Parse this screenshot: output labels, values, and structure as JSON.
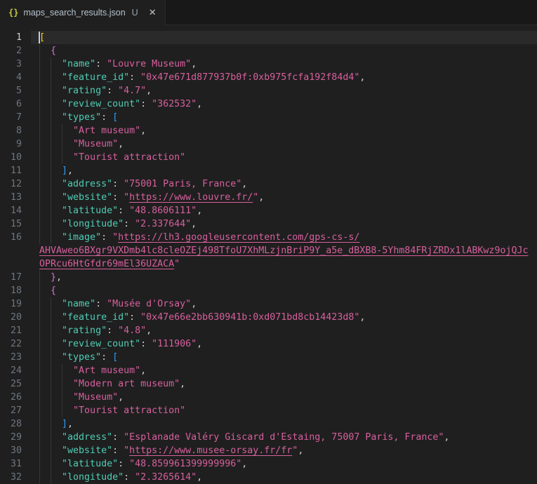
{
  "colors": {
    "editor_bg": "#1f1f1f",
    "tabbar_bg": "#181818",
    "tab_active_bg": "#1f1f1f",
    "tab_border": "#2b2b2b",
    "line_highlight": "#2a2a2a",
    "line_number": "#6e7681",
    "line_number_active": "#cccccc",
    "indent_guide": "#363636",
    "cursor": "#c3ccd5",
    "p": "#cccccc",
    "k": "#4fcdb5",
    "s": "#d7609e",
    "u": "#d7609e",
    "b1": "#ffd602",
    "b2": "#d670d6",
    "b3": "#2f9cf5",
    "tab_label": "#b4c2ce",
    "tab_badge": "#9aa7b0",
    "json_icon": "#cbcb41",
    "close_icon": "#c5c5c5"
  },
  "tab": {
    "icon": "{}",
    "label": "maps_search_results.json",
    "modified_badge": "U",
    "close": "✕"
  },
  "editor": {
    "active_line": 1,
    "lines": [
      {
        "num": "1",
        "ind": 0,
        "seg": [
          [
            "[",
            "b1"
          ]
        ]
      },
      {
        "num": "2",
        "ind": 2,
        "seg": [
          [
            "  ",
            "p"
          ],
          [
            "{",
            "b2"
          ]
        ]
      },
      {
        "num": "3",
        "ind": 4,
        "seg": [
          [
            "    ",
            "p"
          ],
          [
            "\"name\"",
            "k"
          ],
          [
            ": ",
            "p"
          ],
          [
            "\"Louvre Museum\"",
            "s"
          ],
          [
            ",",
            "p"
          ]
        ]
      },
      {
        "num": "4",
        "ind": 4,
        "seg": [
          [
            "    ",
            "p"
          ],
          [
            "\"feature_id\"",
            "k"
          ],
          [
            ": ",
            "p"
          ],
          [
            "\"0x47e671d877937b0f:0xb975fcfa192f84d4\"",
            "s"
          ],
          [
            ",",
            "p"
          ]
        ]
      },
      {
        "num": "5",
        "ind": 4,
        "seg": [
          [
            "    ",
            "p"
          ],
          [
            "\"rating\"",
            "k"
          ],
          [
            ": ",
            "p"
          ],
          [
            "\"4.7\"",
            "s"
          ],
          [
            ",",
            "p"
          ]
        ]
      },
      {
        "num": "6",
        "ind": 4,
        "seg": [
          [
            "    ",
            "p"
          ],
          [
            "\"review_count\"",
            "k"
          ],
          [
            ": ",
            "p"
          ],
          [
            "\"362532\"",
            "s"
          ],
          [
            ",",
            "p"
          ]
        ]
      },
      {
        "num": "7",
        "ind": 4,
        "seg": [
          [
            "    ",
            "p"
          ],
          [
            "\"types\"",
            "k"
          ],
          [
            ": ",
            "p"
          ],
          [
            "[",
            "b3"
          ]
        ]
      },
      {
        "num": "8",
        "ind": 6,
        "seg": [
          [
            "      ",
            "p"
          ],
          [
            "\"Art museum\"",
            "s"
          ],
          [
            ",",
            "p"
          ]
        ]
      },
      {
        "num": "9",
        "ind": 6,
        "seg": [
          [
            "      ",
            "p"
          ],
          [
            "\"Museum\"",
            "s"
          ],
          [
            ",",
            "p"
          ]
        ]
      },
      {
        "num": "10",
        "ind": 6,
        "seg": [
          [
            "      ",
            "p"
          ],
          [
            "\"Tourist attraction\"",
            "s"
          ]
        ]
      },
      {
        "num": "11",
        "ind": 4,
        "seg": [
          [
            "    ",
            "p"
          ],
          [
            "]",
            "b3"
          ],
          [
            ",",
            "p"
          ]
        ]
      },
      {
        "num": "12",
        "ind": 4,
        "seg": [
          [
            "    ",
            "p"
          ],
          [
            "\"address\"",
            "k"
          ],
          [
            ": ",
            "p"
          ],
          [
            "\"75001 Paris, France\"",
            "s"
          ],
          [
            ",",
            "p"
          ]
        ]
      },
      {
        "num": "13",
        "ind": 4,
        "seg": [
          [
            "    ",
            "p"
          ],
          [
            "\"website\"",
            "k"
          ],
          [
            ": ",
            "p"
          ],
          [
            "\"",
            "s"
          ],
          [
            "https://www.louvre.fr/",
            "u"
          ],
          [
            "\"",
            "s"
          ],
          [
            ",",
            "p"
          ]
        ]
      },
      {
        "num": "14",
        "ind": 4,
        "seg": [
          [
            "    ",
            "p"
          ],
          [
            "\"latitude\"",
            "k"
          ],
          [
            ": ",
            "p"
          ],
          [
            "\"48.8606111\"",
            "s"
          ],
          [
            ",",
            "p"
          ]
        ]
      },
      {
        "num": "15",
        "ind": 4,
        "seg": [
          [
            "    ",
            "p"
          ],
          [
            "\"longitude\"",
            "k"
          ],
          [
            ": ",
            "p"
          ],
          [
            "\"2.337644\"",
            "s"
          ],
          [
            ",",
            "p"
          ]
        ]
      },
      {
        "num": "16",
        "ind": 4,
        "seg": [
          [
            "    ",
            "p"
          ],
          [
            "\"image\"",
            "k"
          ],
          [
            ": ",
            "p"
          ],
          [
            "\"",
            "s"
          ],
          [
            "https://lh3.googleusercontent.com/gps-cs-s/",
            "u"
          ]
        ]
      },
      {
        "num": "",
        "ind": 0,
        "seg": [
          [
            "AHVAweo6BXgr9VXDmb4lc8cleOZEj498TfoU7XhMLzjnBriP9Y_a5e_dBXB8-5Yhm84FRjZRDx1lABKwz9ojQJc",
            "u"
          ]
        ]
      },
      {
        "num": "",
        "ind": 0,
        "seg": [
          [
            "OPRcu6HtGfdr69mEl36UZACA",
            "u"
          ],
          [
            "\"",
            "s"
          ]
        ]
      },
      {
        "num": "17",
        "ind": 2,
        "seg": [
          [
            "  ",
            "p"
          ],
          [
            "}",
            "b2"
          ],
          [
            ",",
            "p"
          ]
        ]
      },
      {
        "num": "18",
        "ind": 2,
        "seg": [
          [
            "  ",
            "p"
          ],
          [
            "{",
            "b2"
          ]
        ]
      },
      {
        "num": "19",
        "ind": 4,
        "seg": [
          [
            "    ",
            "p"
          ],
          [
            "\"name\"",
            "k"
          ],
          [
            ": ",
            "p"
          ],
          [
            "\"Musée d'Orsay\"",
            "s"
          ],
          [
            ",",
            "p"
          ]
        ]
      },
      {
        "num": "20",
        "ind": 4,
        "seg": [
          [
            "    ",
            "p"
          ],
          [
            "\"feature_id\"",
            "k"
          ],
          [
            ": ",
            "p"
          ],
          [
            "\"0x47e66e2bb630941b:0xd071bd8cb14423d8\"",
            "s"
          ],
          [
            ",",
            "p"
          ]
        ]
      },
      {
        "num": "21",
        "ind": 4,
        "seg": [
          [
            "    ",
            "p"
          ],
          [
            "\"rating\"",
            "k"
          ],
          [
            ": ",
            "p"
          ],
          [
            "\"4.8\"",
            "s"
          ],
          [
            ",",
            "p"
          ]
        ]
      },
      {
        "num": "22",
        "ind": 4,
        "seg": [
          [
            "    ",
            "p"
          ],
          [
            "\"review_count\"",
            "k"
          ],
          [
            ": ",
            "p"
          ],
          [
            "\"111906\"",
            "s"
          ],
          [
            ",",
            "p"
          ]
        ]
      },
      {
        "num": "23",
        "ind": 4,
        "seg": [
          [
            "    ",
            "p"
          ],
          [
            "\"types\"",
            "k"
          ],
          [
            ": ",
            "p"
          ],
          [
            "[",
            "b3"
          ]
        ]
      },
      {
        "num": "24",
        "ind": 6,
        "seg": [
          [
            "      ",
            "p"
          ],
          [
            "\"Art museum\"",
            "s"
          ],
          [
            ",",
            "p"
          ]
        ]
      },
      {
        "num": "25",
        "ind": 6,
        "seg": [
          [
            "      ",
            "p"
          ],
          [
            "\"Modern art museum\"",
            "s"
          ],
          [
            ",",
            "p"
          ]
        ]
      },
      {
        "num": "26",
        "ind": 6,
        "seg": [
          [
            "      ",
            "p"
          ],
          [
            "\"Museum\"",
            "s"
          ],
          [
            ",",
            "p"
          ]
        ]
      },
      {
        "num": "27",
        "ind": 6,
        "seg": [
          [
            "      ",
            "p"
          ],
          [
            "\"Tourist attraction\"",
            "s"
          ]
        ]
      },
      {
        "num": "28",
        "ind": 4,
        "seg": [
          [
            "    ",
            "p"
          ],
          [
            "]",
            "b3"
          ],
          [
            ",",
            "p"
          ]
        ]
      },
      {
        "num": "29",
        "ind": 4,
        "seg": [
          [
            "    ",
            "p"
          ],
          [
            "\"address\"",
            "k"
          ],
          [
            ": ",
            "p"
          ],
          [
            "\"Esplanade Valéry Giscard d'Estaing, 75007 Paris, France\"",
            "s"
          ],
          [
            ",",
            "p"
          ]
        ]
      },
      {
        "num": "30",
        "ind": 4,
        "seg": [
          [
            "    ",
            "p"
          ],
          [
            "\"website\"",
            "k"
          ],
          [
            ": ",
            "p"
          ],
          [
            "\"",
            "s"
          ],
          [
            "https://www.musee-orsay.fr/fr",
            "u"
          ],
          [
            "\"",
            "s"
          ],
          [
            ",",
            "p"
          ]
        ]
      },
      {
        "num": "31",
        "ind": 4,
        "seg": [
          [
            "    ",
            "p"
          ],
          [
            "\"latitude\"",
            "k"
          ],
          [
            ": ",
            "p"
          ],
          [
            "\"48.859961399999996\"",
            "s"
          ],
          [
            ",",
            "p"
          ]
        ]
      },
      {
        "num": "32",
        "ind": 4,
        "seg": [
          [
            "    ",
            "p"
          ],
          [
            "\"longitude\"",
            "k"
          ],
          [
            ": ",
            "p"
          ],
          [
            "\"2.3265614\"",
            "s"
          ],
          [
            ",",
            "p"
          ]
        ]
      }
    ]
  }
}
